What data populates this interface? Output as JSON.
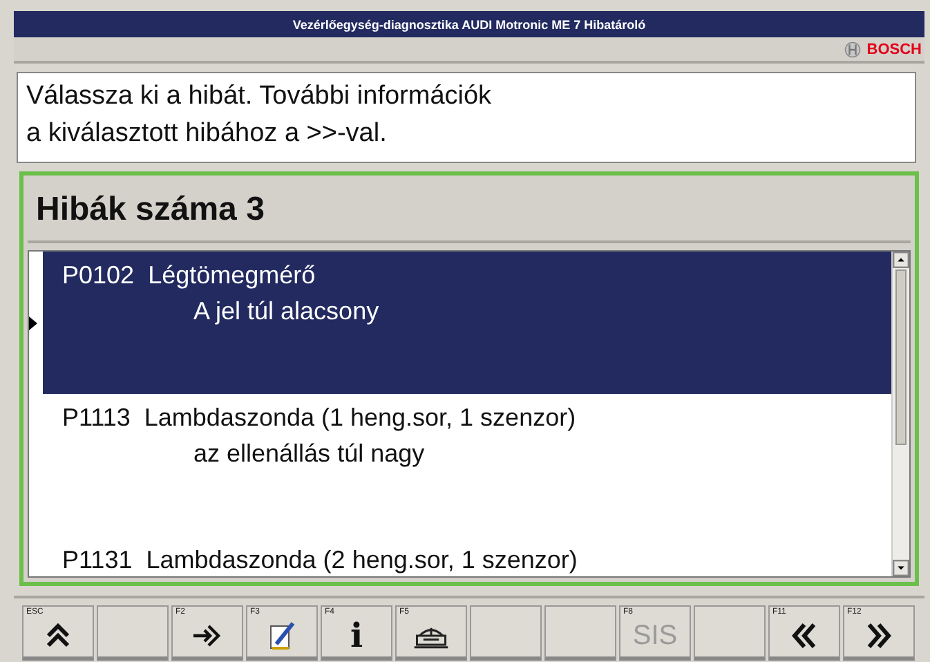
{
  "window": {
    "title": "Vezérlőegység-diagnosztika AUDI Motronic ME 7 Hibatároló"
  },
  "brand": {
    "label": "BOSCH"
  },
  "instruction": [
    "Válassza ki a hibát. További információk",
    "a kiválasztott hibához a >>-val."
  ],
  "faults": {
    "heading": "Hibák száma 3",
    "items": [
      {
        "code": "P0102",
        "name": "Légtömegmérő",
        "detail": "A jel túl alacsony",
        "selected": true
      },
      {
        "code": "P1113",
        "name": "Lambdaszonda (1 heng.sor, 1 szenzor)",
        "detail": "az ellenállás túl nagy",
        "selected": false
      },
      {
        "code": "P1131",
        "name": "Lambdaszonda (2 heng.sor, 1 szenzor)",
        "selected": false
      }
    ]
  },
  "toolbar": [
    {
      "key": "ESC",
      "kind": "up"
    },
    {
      "kind": "empty"
    },
    {
      "key": "F2",
      "kind": "enter"
    },
    {
      "key": "F3",
      "kind": "notepad"
    },
    {
      "key": "F4",
      "kind": "glyph",
      "label": "i"
    },
    {
      "key": "F5",
      "kind": "printer"
    },
    {
      "kind": "empty"
    },
    {
      "kind": "empty"
    },
    {
      "key": "F8",
      "kind": "text",
      "label": "SIS",
      "disabled": true
    },
    {
      "kind": "empty"
    },
    {
      "key": "F11",
      "kind": "back"
    },
    {
      "key": "F12",
      "kind": "forward"
    }
  ]
}
